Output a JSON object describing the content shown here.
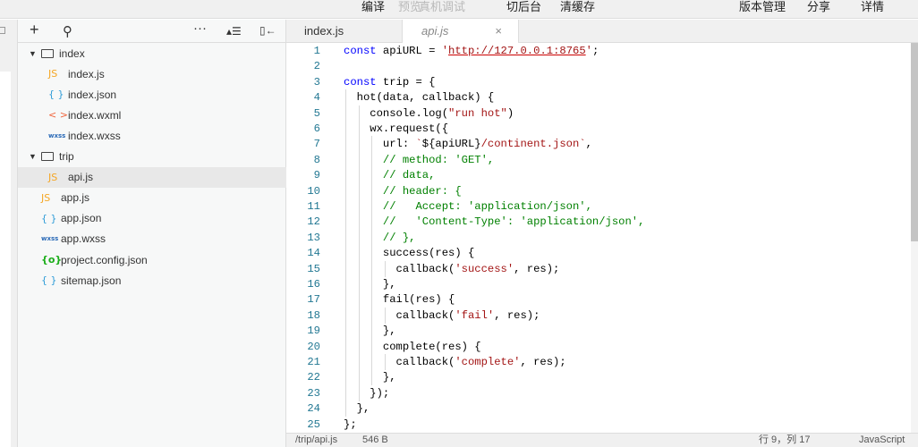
{
  "toolbar": {
    "items": [
      {
        "label": "编译",
        "enabled": true
      },
      {
        "label": "预览",
        "enabled": false
      },
      {
        "label": "真机调试",
        "enabled": false
      },
      {
        "label": "切后台",
        "enabled": true
      },
      {
        "label": "清缓存",
        "enabled": true
      },
      {
        "label": "版本管理",
        "enabled": true
      },
      {
        "label": "分享",
        "enabled": true
      },
      {
        "label": "详情",
        "enabled": true
      }
    ]
  },
  "sidebar": {
    "header_icons": [
      "plus-icon",
      "search-icon",
      "more-icon",
      "collapse-all-icon",
      "hide-panel-icon"
    ],
    "tree": [
      {
        "label": "index",
        "type": "folder",
        "level": 0
      },
      {
        "label": "index.js",
        "type": "js",
        "icon": "JS",
        "level": 1
      },
      {
        "label": "index.json",
        "type": "json",
        "icon": "{ }",
        "level": 1
      },
      {
        "label": "index.wxml",
        "type": "wxml",
        "icon": "< >",
        "level": 1
      },
      {
        "label": "index.wxss",
        "type": "wxss",
        "icon": "wxss",
        "level": 1
      },
      {
        "label": "trip",
        "type": "folder",
        "level": 0
      },
      {
        "label": "api.js",
        "type": "js",
        "icon": "JS",
        "level": 1,
        "selected": true
      },
      {
        "label": "app.js",
        "type": "js",
        "icon": "JS",
        "level": 0
      },
      {
        "label": "app.json",
        "type": "json",
        "icon": "{ }",
        "level": 0
      },
      {
        "label": "app.wxss",
        "type": "wxss",
        "icon": "wxss",
        "level": 0
      },
      {
        "label": "project.config.json",
        "type": "cfg",
        "icon": "{o}",
        "level": 0
      },
      {
        "label": "sitemap.json",
        "type": "json",
        "icon": "{ }",
        "level": 0
      }
    ]
  },
  "tabs": [
    {
      "label": "index.js",
      "active": false
    },
    {
      "label": "api.js",
      "active": true,
      "close": "×"
    }
  ],
  "code": [
    [
      [
        "k",
        "const"
      ],
      [
        "p",
        " apiURL = "
      ],
      [
        "s",
        "'"
      ],
      [
        "su",
        "http://127.0.0.1:8765"
      ],
      [
        "s",
        "'"
      ],
      [
        "p",
        ";"
      ]
    ],
    [],
    [
      [
        "k",
        "const"
      ],
      [
        "p",
        " trip = {"
      ]
    ],
    [
      [
        "p",
        "  hot(data, callback) {"
      ]
    ],
    [
      [
        "p",
        "    console.log("
      ],
      [
        "s",
        "\"run hot\""
      ],
      [
        "p",
        ")"
      ]
    ],
    [
      [
        "p",
        "    wx.request({"
      ]
    ],
    [
      [
        "p",
        "      url: "
      ],
      [
        "s",
        "`"
      ],
      [
        "p",
        "${apiURL}"
      ],
      [
        "s",
        "/continent.json`"
      ],
      [
        "p",
        ","
      ]
    ],
    [
      [
        "p",
        "      "
      ],
      [
        "c",
        "// method: 'GET',"
      ]
    ],
    [
      [
        "p",
        "      "
      ],
      [
        "c",
        "// data,"
      ]
    ],
    [
      [
        "p",
        "      "
      ],
      [
        "c",
        "// header: {"
      ]
    ],
    [
      [
        "p",
        "      "
      ],
      [
        "c",
        "//   Accept: 'application/json',"
      ]
    ],
    [
      [
        "p",
        "      "
      ],
      [
        "c",
        "//   'Content-Type': 'application/json',"
      ]
    ],
    [
      [
        "p",
        "      "
      ],
      [
        "c",
        "// },"
      ]
    ],
    [
      [
        "p",
        "      success(res) {"
      ]
    ],
    [
      [
        "p",
        "        callback("
      ],
      [
        "s",
        "'success'"
      ],
      [
        "p",
        ", res);"
      ]
    ],
    [
      [
        "p",
        "      },"
      ]
    ],
    [
      [
        "p",
        "      fail(res) {"
      ]
    ],
    [
      [
        "p",
        "        callback("
      ],
      [
        "s",
        "'fail'"
      ],
      [
        "p",
        ", res);"
      ]
    ],
    [
      [
        "p",
        "      },"
      ]
    ],
    [
      [
        "p",
        "      complete(res) {"
      ]
    ],
    [
      [
        "p",
        "        callback("
      ],
      [
        "s",
        "'complete'"
      ],
      [
        "p",
        ", res);"
      ]
    ],
    [
      [
        "p",
        "      },"
      ]
    ],
    [
      [
        "p",
        "    });"
      ]
    ],
    [
      [
        "p",
        "  },"
      ]
    ],
    [
      [
        "p",
        "};"
      ]
    ]
  ],
  "status": {
    "path": "/trip/api.js",
    "size": "546 B",
    "position": "行 9，列 17",
    "language": "JavaScript"
  },
  "colors": {
    "keyword": "#0000ff",
    "string": "#a31515",
    "comment": "#008000",
    "line_number": "#237893"
  }
}
